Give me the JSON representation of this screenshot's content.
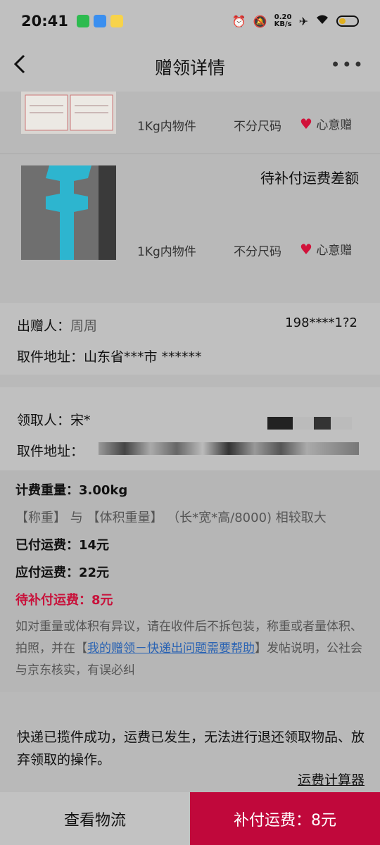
{
  "status_bar": {
    "time": "20:41",
    "net_speed_value": "0.20",
    "net_speed_unit": "KB/s",
    "icons": [
      "wechat-icon",
      "messenger-icon",
      "app-100-icon",
      "alarm-icon",
      "mute-icon",
      "airplane-icon",
      "wifi-icon",
      "battery-icon"
    ]
  },
  "header": {
    "title": "赠领详情",
    "back_icon": "chevron-left-icon",
    "more_icon": "more-dots-icon"
  },
  "items": [
    {
      "weight": "1Kg内物件",
      "size": "不分尺码",
      "tag": "心意赠"
    },
    {
      "status": "待补付运费差额",
      "weight": "1Kg内物件",
      "size": "不分尺码",
      "tag": "心意赠"
    }
  ],
  "giver": {
    "name_label": "出赠人：",
    "name_value": "周周",
    "phone": "198****1?2",
    "address_label": "取件地址：",
    "address_value": "山东省***市 ******"
  },
  "receiver": {
    "name_label": "领取人：",
    "name_value": "宋*",
    "address_label": "取件地址："
  },
  "fee": {
    "weight_line": "计费重量：3.00kg",
    "rule": "【称重】 与 【体积重量】 （长*宽*高/8000) 相较取大",
    "paid": "已付运费：14元",
    "due": "应付运费：22元",
    "pending": "待补付运费：8元",
    "notice_pre": "如对重量或体积有异议，请在收件后不拆包装，称重或者量体积、拍照，并在【",
    "notice_link": "我的赠领－快递出问题需要帮助",
    "notice_post": "】发帖说明，公社会与京东核实，有误必纠"
  },
  "final_note": "快递已揽件成功，运费已发生，无法进行退还领取物品、放弃领取的操作。",
  "calculator_link": "运费计算器",
  "buttons": {
    "logistics": "查看物流",
    "pay": "补付运费：8元"
  },
  "colors": {
    "accent": "#c0083b",
    "pending_text": "#c8123b",
    "link": "#2a63b3"
  }
}
